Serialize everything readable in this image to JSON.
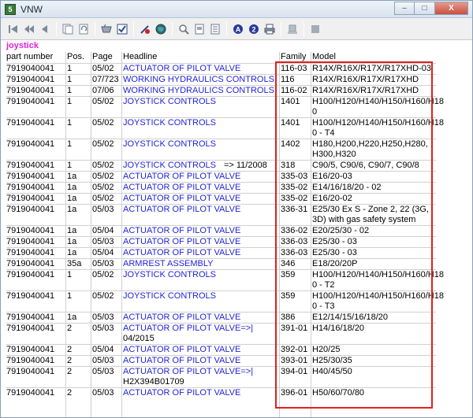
{
  "window": {
    "title": "VNW",
    "app_icon_label": "5"
  },
  "window_controls": {
    "minimize": "–",
    "maximize": "□",
    "close": "X"
  },
  "toolbar_icons": [
    "first-page-icon",
    "prev-fast-icon",
    "prev-icon",
    "pages-icon",
    "page-refresh-icon",
    "basket-icon",
    "checklist-icon",
    "pen-cancel-icon",
    "globe-icon",
    "zoom-icon",
    "page-icon",
    "document-icon",
    "a-circle-icon",
    "two-circle-icon",
    "print-icon",
    "stamp-icon",
    "stop-icon"
  ],
  "search": {
    "term": "joystick"
  },
  "columns": {
    "part": "part number",
    "pos": "Pos.",
    "page": "Page",
    "headline": "Headline",
    "family": "Family",
    "model": "Model"
  },
  "rows": [
    {
      "part": "7919040041",
      "pos": "1",
      "page": "05/02",
      "headline": "ACTUATOR OF PILOT VALVE",
      "note": "",
      "family": "116-03",
      "model": [
        "R14X/R16X/R17X/R17XHD-03"
      ]
    },
    {
      "part": "7919040041",
      "pos": "1",
      "page": "07/723",
      "headline": "WORKING HYDRAULICS CONTROLS",
      "note": "",
      "family": "116",
      "model": [
        "R14X/R16X/R17X/R17XHD"
      ]
    },
    {
      "part": "7919040041",
      "pos": "1",
      "page": "07/06",
      "headline": "WORKING HYDRAULICS CONTROLS",
      "note": "",
      "family": "116-02",
      "model": [
        "R14X/R16X/R17X/R17XHD"
      ]
    },
    {
      "part": "7919040041",
      "pos": "1",
      "page": "05/02",
      "headline": "JOYSTICK CONTROLS",
      "note": "",
      "family": "1401",
      "model": [
        "H100/H120/H140/H150/H160/H18",
        "0"
      ]
    },
    {
      "part": "7919040041",
      "pos": "1",
      "page": "05/02",
      "headline": "JOYSTICK CONTROLS",
      "note": "",
      "family": "1401",
      "model": [
        "H100/H120/H140/H150/H160/H18",
        "0 - T4"
      ]
    },
    {
      "part": "7919040041",
      "pos": "1",
      "page": "05/02",
      "headline": "JOYSTICK CONTROLS",
      "note": "",
      "family": "1402",
      "model": [
        "H180,H200,H220,H250,H280,",
        "H300,H320"
      ]
    },
    {
      "part": "7919040041",
      "pos": "1",
      "page": "05/02",
      "headline": "JOYSTICK CONTROLS",
      "note": "=> 11/2008",
      "family": "318",
      "model": [
        "C90/5, C90/6, C90/7, C90/8"
      ]
    },
    {
      "part": "7919040041",
      "pos": "1a",
      "page": "05/02",
      "headline": "ACTUATOR OF PILOT VALVE",
      "note": "",
      "family": "335-03",
      "model": [
        "E16/20-03"
      ]
    },
    {
      "part": "7919040041",
      "pos": "1a",
      "page": "05/02",
      "headline": "ACTUATOR OF PILOT VALVE",
      "note": "",
      "family": "335-02",
      "model": [
        "E14/16/18/20 - 02"
      ]
    },
    {
      "part": "7919040041",
      "pos": "1a",
      "page": "05/02",
      "headline": "ACTUATOR OF PILOT VALVE",
      "note": "",
      "family": "335-02",
      "model": [
        "E16/20-02"
      ]
    },
    {
      "part": "7919040041",
      "pos": "1a",
      "page": "05/03",
      "headline": "ACTUATOR OF PILOT VALVE",
      "note": "",
      "family": "336-31",
      "model": [
        "E25/30 Ex S - Zone 2, 22 (3G,",
        "3D) with gas safety system"
      ]
    },
    {
      "part": "7919040041",
      "pos": "1a",
      "page": "05/04",
      "headline": "ACTUATOR OF PILOT VALVE",
      "note": "",
      "family": "336-02",
      "model": [
        "E20/25/30 - 02"
      ]
    },
    {
      "part": "7919040041",
      "pos": "1a",
      "page": "05/03",
      "headline": "ACTUATOR OF PILOT VALVE",
      "note": "",
      "family": "336-03",
      "model": [
        "E25/30 - 03"
      ]
    },
    {
      "part": "7919040041",
      "pos": "1a",
      "page": "05/04",
      "headline": "ACTUATOR OF PILOT VALVE",
      "note": "",
      "family": "336-03",
      "model": [
        "E25/30 - 03"
      ]
    },
    {
      "part": "7919040041",
      "pos": "35a",
      "page": "05/03",
      "headline": "ARMREST ASSEMBLY",
      "note": "",
      "family": "346",
      "model": [
        "E18/20/20P"
      ]
    },
    {
      "part": "7919040041",
      "pos": "1",
      "page": "05/02",
      "headline": "JOYSTICK CONTROLS",
      "note": "",
      "family": "359",
      "model": [
        "H100/H120/H140/H150/H160/H18",
        "0 - T2"
      ]
    },
    {
      "part": "7919040041",
      "pos": "1",
      "page": "05/02",
      "headline": "JOYSTICK CONTROLS",
      "note": "",
      "family": "359",
      "model": [
        "H100/H120/H140/H150/H160/H18",
        "0 - T3"
      ]
    },
    {
      "part": "7919040041",
      "pos": "1a",
      "page": "05/03",
      "headline": "ACTUATOR OF PILOT VALVE",
      "note": "",
      "family": "386",
      "model": [
        "E12/14/15/16/18/20"
      ]
    },
    {
      "part": "7919040041",
      "pos": "2",
      "page": "05/03",
      "headline": "ACTUATOR OF PILOT VALVE=>|",
      "note": "",
      "headline2": "04/2015",
      "family": "391-01",
      "model": [
        "H14/16/18/20"
      ]
    },
    {
      "part": "7919040041",
      "pos": "2",
      "page": "05/04",
      "headline": "ACTUATOR OF PILOT VALVE",
      "note": "",
      "family": "392-01",
      "model": [
        "H20/25"
      ]
    },
    {
      "part": "7919040041",
      "pos": "2",
      "page": "05/03",
      "headline": "ACTUATOR OF PILOT VALVE",
      "note": "",
      "family": "393-01",
      "model": [
        "H25/30/35"
      ]
    },
    {
      "part": "7919040041",
      "pos": "2",
      "page": "05/03",
      "headline": "ACTUATOR OF PILOT VALVE=>|",
      "note": "",
      "headline2": "H2X394B01709",
      "family": "394-01",
      "model": [
        "H40/45/50"
      ]
    },
    {
      "part": "7919040041",
      "pos": "2",
      "page": "05/03",
      "headline": "ACTUATOR OF PILOT VALVE",
      "note": "",
      "family": "396-01",
      "model": [
        "H50/60/70/80"
      ]
    }
  ],
  "colors": {
    "link": "#2323d8",
    "search_term": "#e020e0",
    "highlight": "#e02020"
  }
}
